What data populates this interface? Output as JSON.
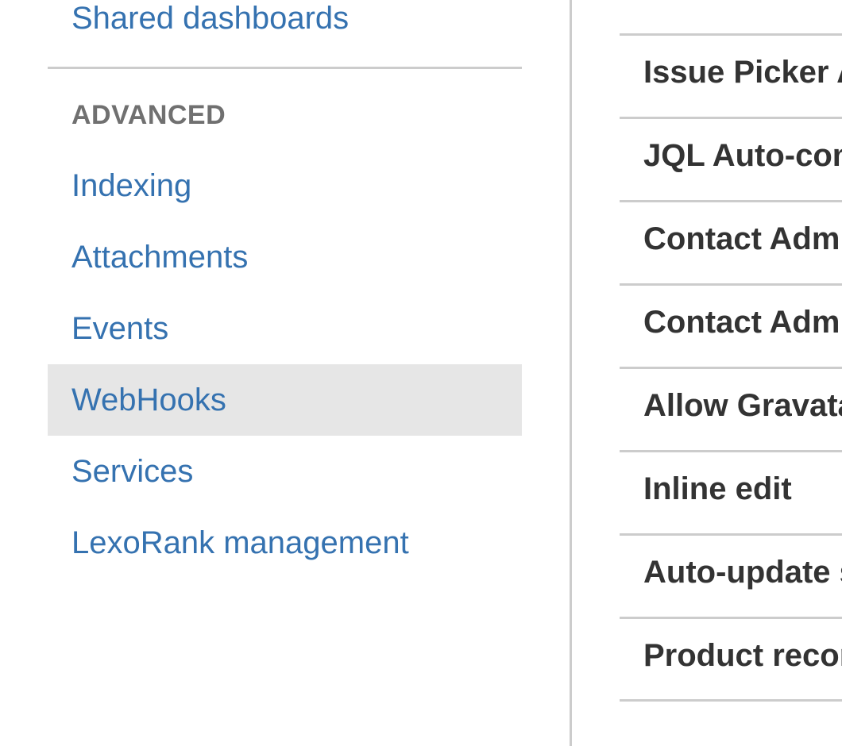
{
  "sidebar": {
    "top_link": "Shared dashboards",
    "section_heading": "ADVANCED",
    "items": [
      {
        "label": "Indexing",
        "selected": false
      },
      {
        "label": "Attachments",
        "selected": false
      },
      {
        "label": "Events",
        "selected": false
      },
      {
        "label": "WebHooks",
        "selected": true
      },
      {
        "label": "Services",
        "selected": false
      },
      {
        "label": "LexoRank management",
        "selected": false
      }
    ]
  },
  "settings": {
    "rows": [
      {
        "label": "Issue Picker Auto-complete"
      },
      {
        "label": "JQL Auto-complete"
      },
      {
        "label": "Contact Administrators Form"
      },
      {
        "label": "Contact Administrators Message"
      },
      {
        "label": "Allow Gravatars"
      },
      {
        "label": "Inline edit"
      },
      {
        "label": "Auto-update search results"
      },
      {
        "label": "Product recommendations"
      }
    ]
  },
  "colors": {
    "link": "#3572b0",
    "heading": "#707070",
    "label": "#333333",
    "divider": "#cccccc",
    "selected_bg": "#e6e6e6"
  }
}
